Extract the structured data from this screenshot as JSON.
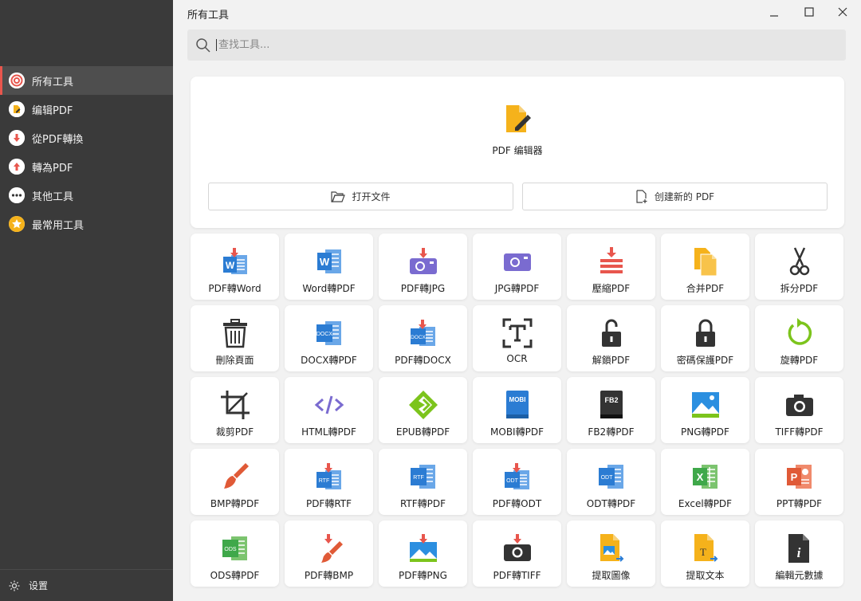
{
  "window": {
    "title": "所有工具"
  },
  "search": {
    "placeholder": "查找工具..."
  },
  "sidebar": {
    "items": [
      {
        "label": "所有工具",
        "icon": "all-tools-icon"
      },
      {
        "label": "编辑PDF",
        "icon": "edit-pdf-icon"
      },
      {
        "label": "從PDF轉換",
        "icon": "convert-from-pdf-icon"
      },
      {
        "label": "轉為PDF",
        "icon": "convert-to-pdf-icon"
      },
      {
        "label": "其他工具",
        "icon": "more-tools-icon"
      },
      {
        "label": "最常用工具",
        "icon": "star-icon"
      }
    ],
    "settings_label": "设置"
  },
  "editor": {
    "label": "PDF 编辑器",
    "open_label": "打开文件",
    "create_label": "创建新的 PDF"
  },
  "tools": [
    {
      "label": "PDF轉Word",
      "icon": "pdf-to-word-icon"
    },
    {
      "label": "Word轉PDF",
      "icon": "word-to-pdf-icon"
    },
    {
      "label": "PDF轉JPG",
      "icon": "pdf-to-jpg-icon"
    },
    {
      "label": "JPG轉PDF",
      "icon": "jpg-to-pdf-icon"
    },
    {
      "label": "壓縮PDF",
      "icon": "compress-pdf-icon"
    },
    {
      "label": "合并PDF",
      "icon": "merge-pdf-icon"
    },
    {
      "label": "拆分PDF",
      "icon": "scissors-icon"
    },
    {
      "label": "刪除頁面",
      "icon": "trash-icon"
    },
    {
      "label": "DOCX轉PDF",
      "icon": "docx-to-pdf-icon"
    },
    {
      "label": "PDF轉DOCX",
      "icon": "pdf-to-docx-icon"
    },
    {
      "label": "OCR",
      "icon": "ocr-icon"
    },
    {
      "label": "解鎖PDF",
      "icon": "unlock-icon"
    },
    {
      "label": "密碼保護PDF",
      "icon": "lock-icon"
    },
    {
      "label": "旋轉PDF",
      "icon": "rotate-icon"
    },
    {
      "label": "裁剪PDF",
      "icon": "crop-icon"
    },
    {
      "label": "HTML轉PDF",
      "icon": "html-code-icon"
    },
    {
      "label": "EPUB轉PDF",
      "icon": "epub-icon"
    },
    {
      "label": "MOBI轉PDF",
      "icon": "mobi-icon"
    },
    {
      "label": "FB2轉PDF",
      "icon": "fb2-icon"
    },
    {
      "label": "PNG轉PDF",
      "icon": "png-image-icon"
    },
    {
      "label": "TIFF轉PDF",
      "icon": "camera-icon"
    },
    {
      "label": "BMP轉PDF",
      "icon": "paintbrush-icon"
    },
    {
      "label": "PDF轉RTF",
      "icon": "pdf-to-rtf-icon"
    },
    {
      "label": "RTF轉PDF",
      "icon": "rtf-to-pdf-icon"
    },
    {
      "label": "PDF轉ODT",
      "icon": "pdf-to-odt-icon"
    },
    {
      "label": "ODT轉PDF",
      "icon": "odt-to-pdf-icon"
    },
    {
      "label": "Excel轉PDF",
      "icon": "excel-icon"
    },
    {
      "label": "PPT轉PDF",
      "icon": "powerpoint-icon"
    },
    {
      "label": "ODS轉PDF",
      "icon": "ods-icon"
    },
    {
      "label": "PDF轉BMP",
      "icon": "pdf-to-bmp-icon"
    },
    {
      "label": "PDF轉PNG",
      "icon": "pdf-to-png-icon"
    },
    {
      "label": "PDF轉TIFF",
      "icon": "pdf-to-tiff-icon"
    },
    {
      "label": "提取圖像",
      "icon": "extract-image-icon"
    },
    {
      "label": "提取文本",
      "icon": "extract-text-icon"
    },
    {
      "label": "編輯元數據",
      "icon": "metadata-info-icon"
    }
  ],
  "colors": {
    "sidebar_bg": "#3a3a3a",
    "active_item_bg": "#4e4e4e",
    "accent": "#e8564d",
    "word_blue": "#2b7cd3",
    "pdf_yellow": "#f5b21b",
    "excel_green": "#3fa84a",
    "ppt_orange": "#e05a37",
    "epub_green": "#7cc41c",
    "photo_purple": "#7a6bd0"
  }
}
